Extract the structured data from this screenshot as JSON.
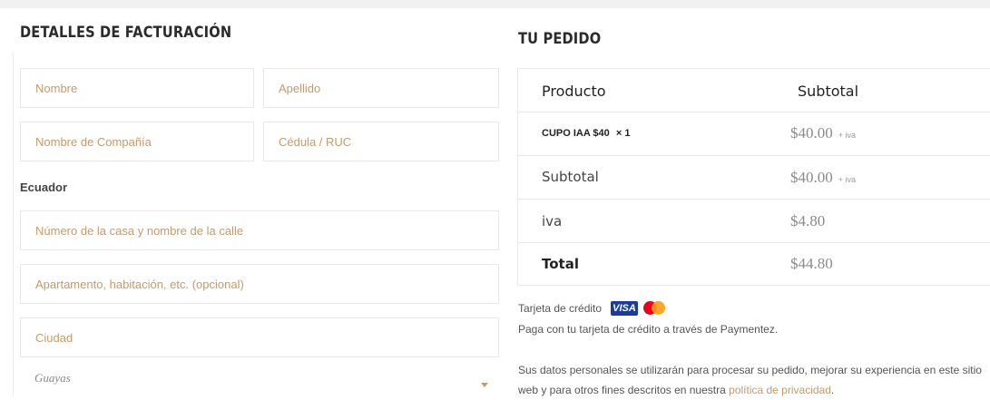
{
  "billing": {
    "title": "DETALLES DE FACTURACIÓN",
    "first_name_placeholder": "Nombre",
    "last_name_placeholder": "Apellido",
    "company_placeholder": "Nombre de Compañía",
    "id_placeholder": "Cédula / RUC",
    "country": "Ecuador",
    "address1_placeholder": "Número de la casa y nombre de la calle",
    "address2_placeholder": "Apartamento, habitación, etc. (opcional)",
    "city_placeholder": "Ciudad",
    "state_value": "Guayas"
  },
  "order": {
    "title": "TU PEDIDO",
    "col_product": "Producto",
    "col_subtotal": "Subtotal",
    "item_name": "CUPO IAA $40",
    "item_qty": "× 1",
    "item_price": "$40.00",
    "item_tax_tag": "+ iva",
    "subtotal_label": "Subtotal",
    "subtotal_value": "$40.00",
    "subtotal_tax_tag": "+ iva",
    "tax_label": "iva",
    "tax_value": "$4.80",
    "total_label": "Total",
    "total_value": "$44.80"
  },
  "payment": {
    "method_label": "Tarjeta de crédito",
    "visa_text": "VISA",
    "description": "Paga con tu tarjeta de crédito a través de Paymentez.",
    "privacy_text": "Sus datos personales se utilizarán para procesar su pedido, mejorar su experiencia en este sitio web y para otros fines descritos en nuestra",
    "privacy_link": "política de privacidad",
    "privacy_end": "."
  },
  "colors": {
    "placeholder": "#c49a6c",
    "visa_blue": "#1a3c9c",
    "mc_red": "#eb001b",
    "mc_orange": "#f79e1b"
  }
}
